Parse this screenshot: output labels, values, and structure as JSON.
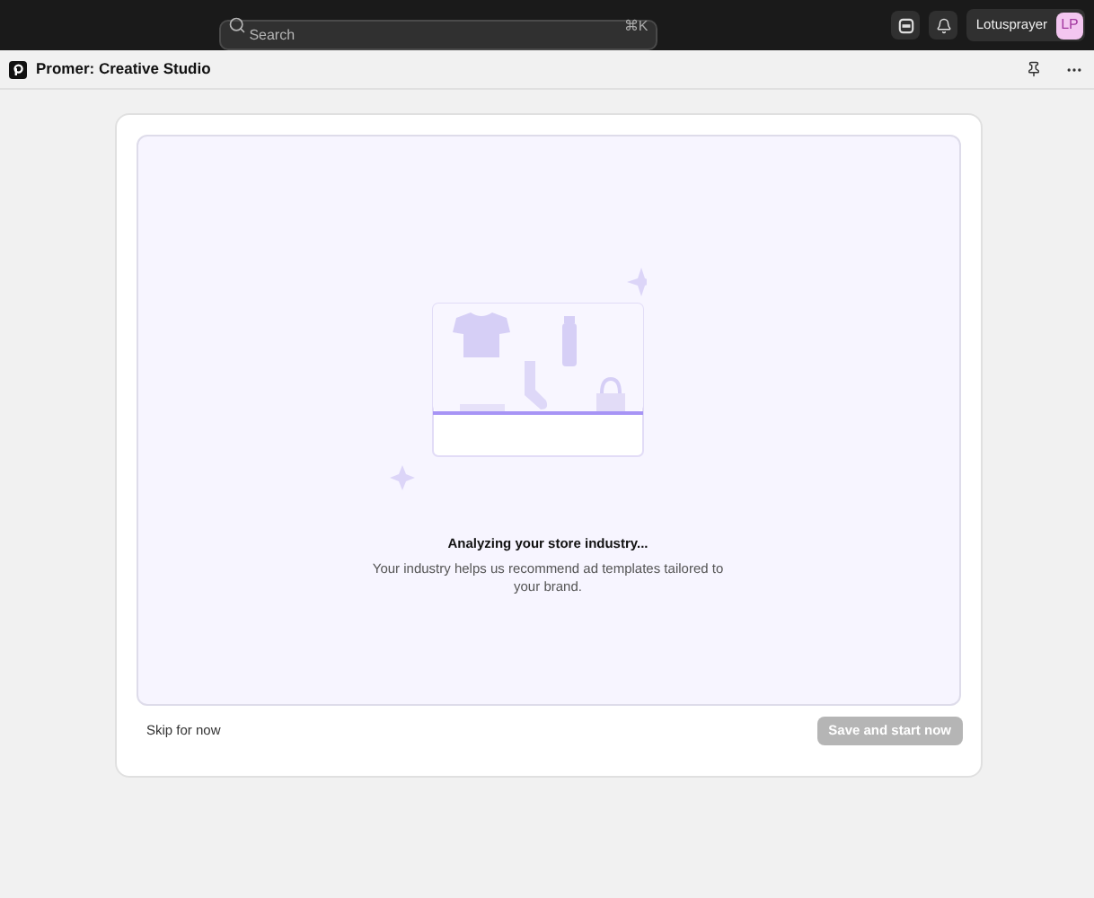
{
  "top_bar": {
    "search": {
      "placeholder": "Search",
      "shortcut": "⌘K"
    },
    "user": {
      "name": "Lotusprayer",
      "initials": "LP"
    }
  },
  "app_bar": {
    "title": "Promer: Creative Studio"
  },
  "onboarding": {
    "title": "Analyzing your store industry...",
    "description": "Your industry helps us recommend ad templates tailored to your brand.",
    "skip_link": "Skip for now",
    "primary_button": {
      "label": "Save and start now",
      "disabled": true
    }
  }
}
